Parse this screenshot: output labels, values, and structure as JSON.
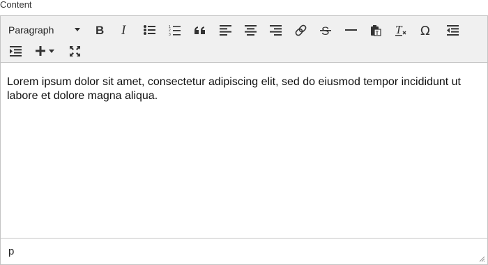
{
  "field": {
    "label": "Content"
  },
  "toolbar": {
    "heading": {
      "selected": "Paragraph"
    },
    "buttons": [
      {
        "id": "bold",
        "icon": "bold-icon"
      },
      {
        "id": "italic",
        "icon": "italic-icon"
      },
      {
        "id": "bulleted-list",
        "icon": "bulleted-list-icon"
      },
      {
        "id": "numbered-list",
        "icon": "numbered-list-icon"
      },
      {
        "id": "block-quote",
        "icon": "block-quote-icon"
      },
      {
        "id": "align-left",
        "icon": "align-left-icon"
      },
      {
        "id": "align-center",
        "icon": "align-center-icon"
      },
      {
        "id": "align-right",
        "icon": "align-right-icon"
      },
      {
        "id": "link",
        "icon": "link-icon"
      },
      {
        "id": "strikethrough",
        "icon": "strikethrough-icon"
      },
      {
        "id": "horizontal-line",
        "icon": "horizontal-line-icon"
      },
      {
        "id": "paste-plain-text",
        "icon": "paste-plain-text-icon"
      },
      {
        "id": "remove-format",
        "icon": "remove-format-icon"
      },
      {
        "id": "special-characters",
        "icon": "omega-icon"
      },
      {
        "id": "outdent",
        "icon": "outdent-icon"
      },
      {
        "id": "indent",
        "icon": "indent-icon"
      },
      {
        "id": "insert",
        "icon": "plus-icon"
      },
      {
        "id": "fullscreen",
        "icon": "fullscreen-icon"
      }
    ]
  },
  "content": {
    "text": "Lorem ipsum dolor sit amet, consectetur adipiscing elit, sed do eiusmod tempor incididunt ut labore et dolore magna aliqua."
  },
  "statusbar": {
    "path": "p"
  }
}
